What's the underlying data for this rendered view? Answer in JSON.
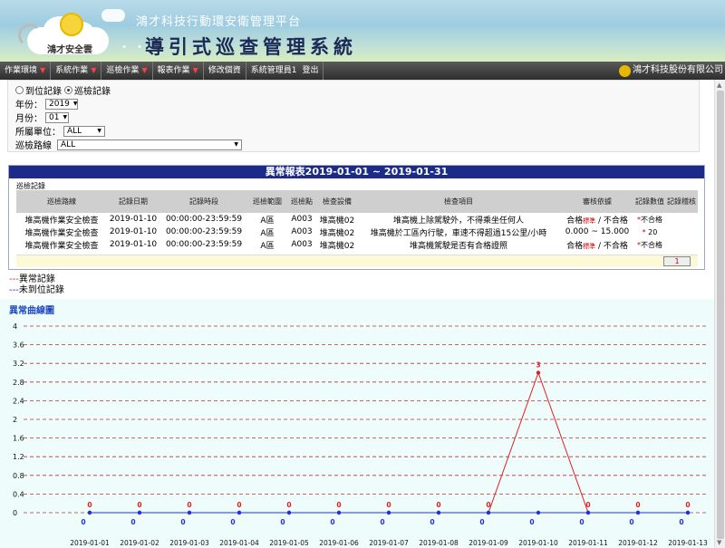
{
  "header": {
    "logo_text": "鴻才安全雲",
    "platform_title": "鴻才科技行動環安衛管理平台",
    "system_title": "導引式巡查管理系統",
    "dots": "・・・",
    "company": "鴻才科技股份有限公司"
  },
  "menu": {
    "items": [
      {
        "label": "作業環境",
        "arrow": "▼"
      },
      {
        "label": "系統作業",
        "arrow": "▼"
      },
      {
        "label": "巡檢作業",
        "arrow": "▼"
      },
      {
        "label": "報表作業",
        "arrow": "▼"
      },
      {
        "label": "修改個資",
        "arrow": ""
      },
      {
        "label": "系統管理員1",
        "arrow": ""
      },
      {
        "label": "登出",
        "arrow": ""
      }
    ]
  },
  "filters": {
    "radio1": "到位記錄",
    "radio2": "巡檢記錄",
    "year_label": "年份：",
    "year_value": "2019",
    "month_label": "月份：",
    "month_value": "01",
    "unit_label": "所屬單位：",
    "unit_value": "ALL",
    "route_label": "巡檢路線",
    "route_value": "ALL"
  },
  "report": {
    "title": "異常報表2019-01-01 ~ 2019-01-31",
    "inner_label": "巡檢記錄",
    "headers": [
      "巡檢路線",
      "記錄日期",
      "記錄時段",
      "巡檢範圍",
      "巡檢點",
      "檢查設備",
      "檢查項目",
      "審核依據",
      "記錄數值",
      "記錄稽核"
    ],
    "rows": [
      {
        "route": "堆高機作業安全檢查",
        "date": "2019-01-10",
        "period": "00:00:00-23:59:59",
        "area": "A區",
        "point": "A003",
        "device": "堆高機02",
        "item": "堆高機上除駕駛外，不得乘坐任何人",
        "basis_a": "合格",
        "basis_std": "標準",
        "basis_b": " / 不合格",
        "mark": "*",
        "value": "不合格",
        "audit": ""
      },
      {
        "route": "堆高機作業安全檢查",
        "date": "2019-01-10",
        "period": "00:00:00-23:59:59",
        "area": "A區",
        "point": "A003",
        "device": "堆高機02",
        "item": "堆高機於工區內行駛，車速不得超過15公里/小時",
        "basis_a": "0.000 ~ 15.000",
        "basis_std": "",
        "basis_b": "",
        "mark": "*",
        "value": " 20",
        "audit": ""
      },
      {
        "route": "堆高機作業安全檢查",
        "date": "2019-01-10",
        "period": "00:00:00-23:59:59",
        "area": "A區",
        "point": "A003",
        "device": "堆高機02",
        "item": "堆高機駕駛是否有合格證照",
        "basis_a": "合格",
        "basis_std": "標準",
        "basis_b": " / 不合格",
        "mark": "*",
        "value": "不合格",
        "audit": ""
      }
    ],
    "page": "1"
  },
  "legend": {
    "abnormal_line": "---",
    "abnormal": "異常記錄",
    "missing_line": "---",
    "missing": "未到位記錄"
  },
  "chart_title": "異常曲線圖",
  "chart_data": {
    "type": "line",
    "x": [
      "2019-01-01",
      "2019-01-02",
      "2019-01-03",
      "2019-01-04",
      "2019-01-05",
      "2019-01-06",
      "2019-01-07",
      "2019-01-08",
      "2019-01-09",
      "2019-01-10",
      "2019-01-11",
      "2019-01-12",
      "2019-01-13"
    ],
    "ylim": [
      0,
      4
    ],
    "yticks": [
      "0",
      "0.4",
      "0.8",
      "1.2",
      "1.6",
      "2",
      "2.4",
      "2.8",
      "3.2",
      "3.6",
      "4"
    ],
    "grid": true,
    "series": [
      {
        "color": "#e02020",
        "values": [
          0,
          0,
          0,
          0,
          0,
          0,
          0,
          0,
          0,
          3,
          0,
          0,
          0
        ]
      },
      {
        "color": "#2030e0",
        "values": [
          0,
          0,
          0,
          0,
          0,
          0,
          0,
          0,
          0,
          0,
          0,
          0,
          0
        ]
      }
    ]
  }
}
